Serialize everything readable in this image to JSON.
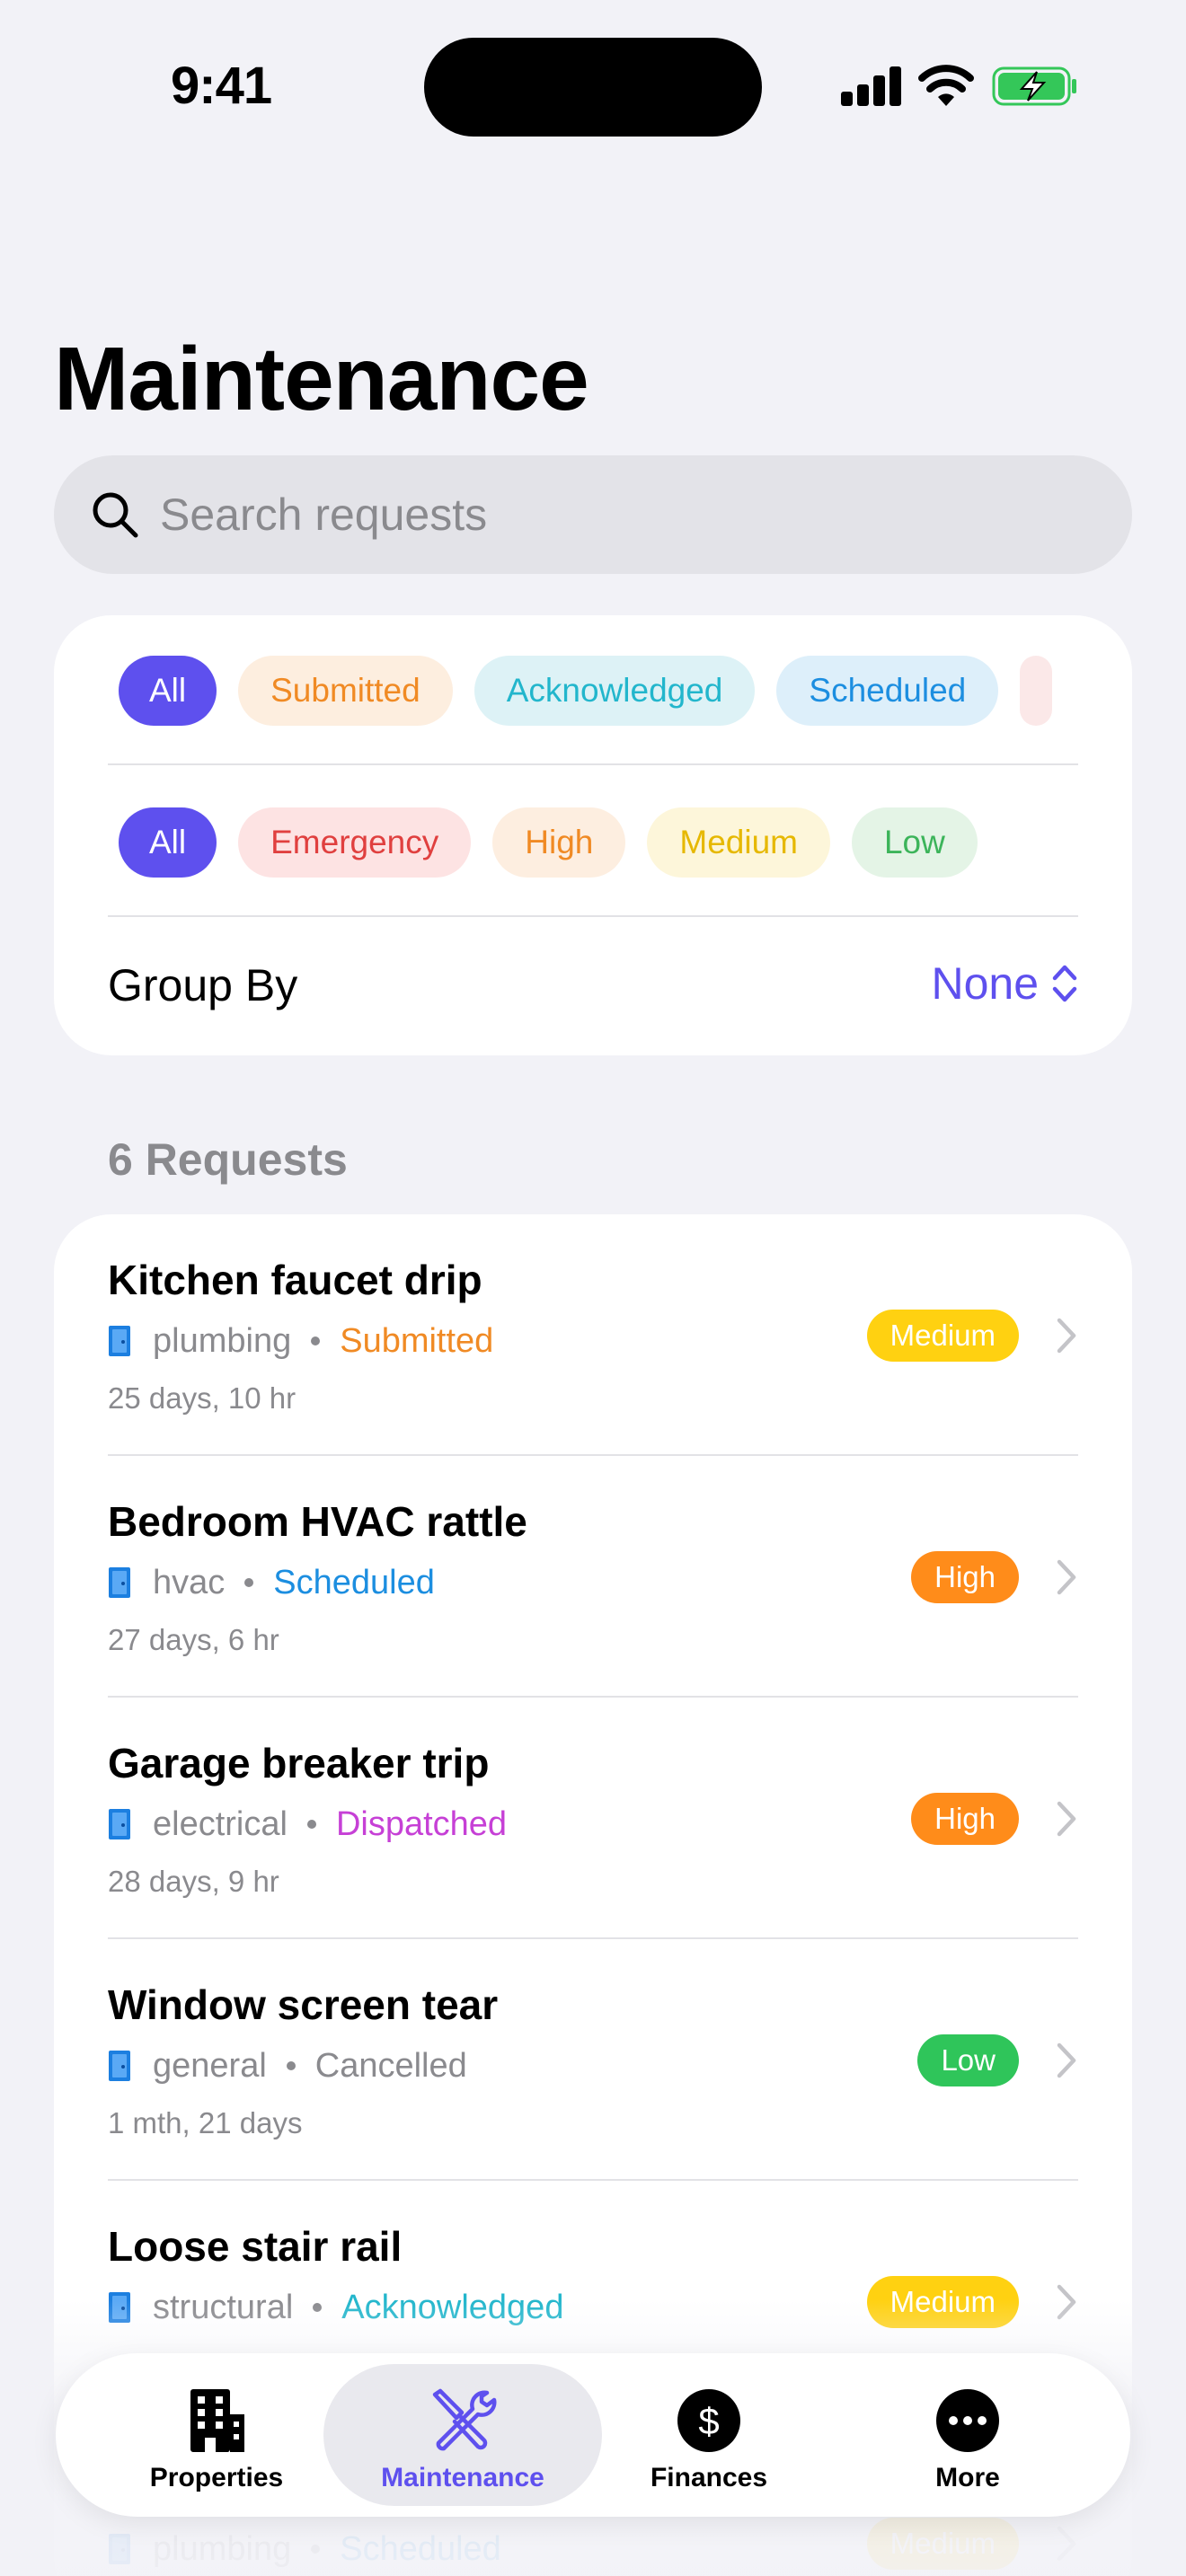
{
  "status_bar": {
    "time": "9:41"
  },
  "page": {
    "title": "Maintenance"
  },
  "search": {
    "placeholder": "Search requests"
  },
  "filters": {
    "status_chips": [
      "All",
      "Submitted",
      "Acknowledged",
      "Scheduled"
    ],
    "priority_chips": [
      "All",
      "Emergency",
      "High",
      "Medium",
      "Low"
    ],
    "group_by_label": "Group By",
    "group_by_value": "None"
  },
  "requests": {
    "count_label": "6 Requests",
    "items": [
      {
        "title": "Kitchen faucet drip",
        "category": "plumbing",
        "status": "Submitted",
        "status_color": "#f08a24",
        "age": "25 days, 10 hr",
        "priority": "Medium"
      },
      {
        "title": "Bedroom HVAC rattle",
        "category": "hvac",
        "status": "Scheduled",
        "status_color": "#1c8ee0",
        "age": "27 days, 6 hr",
        "priority": "High"
      },
      {
        "title": "Garage breaker trip",
        "category": "electrical",
        "status": "Dispatched",
        "status_color": "#c640d6",
        "age": "28 days, 9 hr",
        "priority": "High"
      },
      {
        "title": "Window screen tear",
        "category": "general",
        "status": "Cancelled",
        "status_color": "#8a8a8e",
        "age": "1 mth, 21 days",
        "priority": "Low"
      },
      {
        "title": "Loose stair rail",
        "category": "structural",
        "status": "Acknowledged",
        "status_color": "#22b6cc",
        "age": "",
        "priority": "Medium"
      },
      {
        "title": "",
        "category": "plumbing",
        "status": "Scheduled",
        "status_color": "#1c8ee0",
        "age": "",
        "priority": "Medium"
      }
    ]
  },
  "tab_bar": {
    "tabs": [
      {
        "label": "Properties",
        "icon": "building-icon"
      },
      {
        "label": "Maintenance",
        "icon": "wrench-screwdriver-icon"
      },
      {
        "label": "Finances",
        "icon": "dollar-circle-icon"
      },
      {
        "label": "More",
        "icon": "ellipsis-circle-icon"
      }
    ],
    "active_index": 1
  },
  "colors": {
    "accent": "#5e50ee",
    "background": "#f2f2f7",
    "door_icon": "#1c7fe0"
  }
}
